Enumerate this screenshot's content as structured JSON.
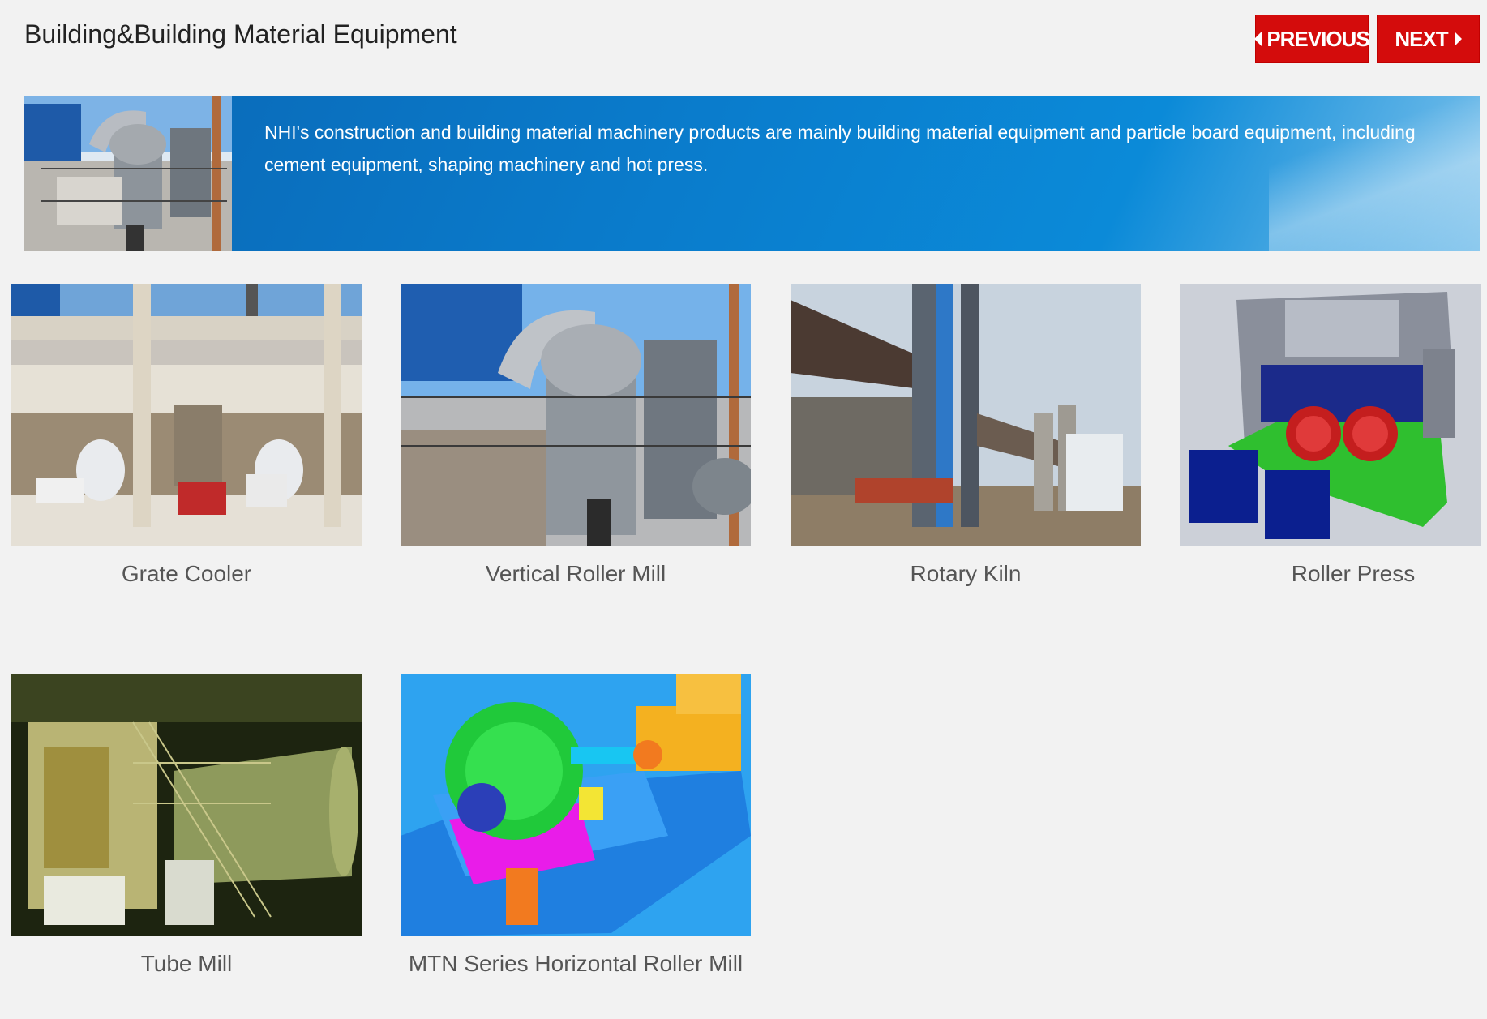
{
  "header": {
    "title": "Building&Building Material Equipment",
    "previous_label": "PREVIOUS",
    "next_label": "NEXT",
    "button_color": "#d40c0c"
  },
  "banner": {
    "text": "NHI's construction and building material machinery products are mainly building material equipment and particle board equipment, including cement equipment, shaping machinery and hot press.",
    "color": "#0a7ccc"
  },
  "products": [
    {
      "name": "Grate Cooler"
    },
    {
      "name": "Vertical Roller Mill"
    },
    {
      "name": "Rotary Kiln"
    },
    {
      "name": "Roller Press"
    },
    {
      "name": "Tube Mill"
    },
    {
      "name": "MTN Series Horizontal Roller Mill"
    }
  ],
  "icons": {
    "previous": "triangle-left-icon",
    "next": "triangle-right-icon"
  }
}
